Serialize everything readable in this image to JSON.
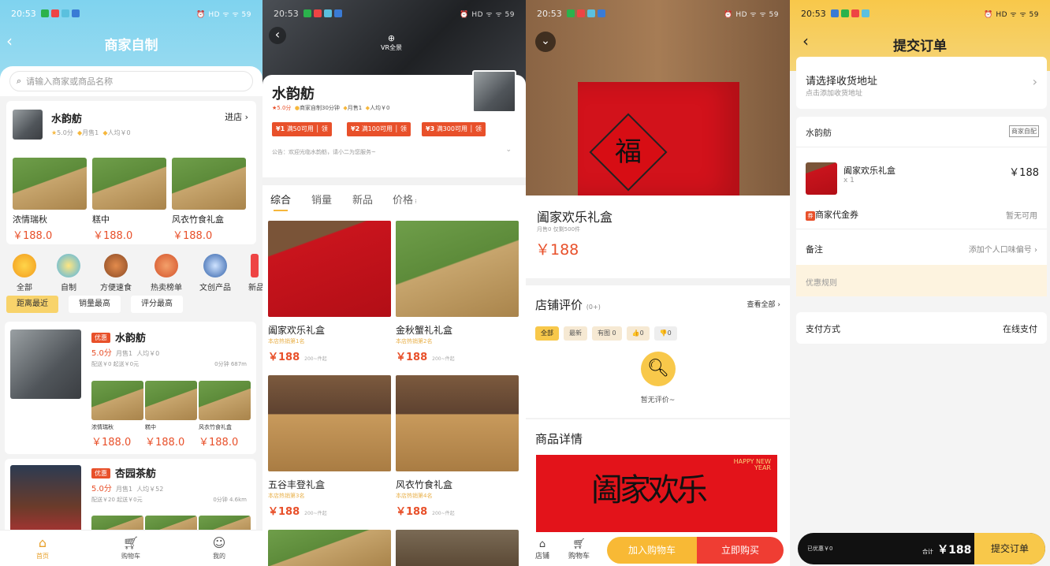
{
  "status": {
    "time": "20:53",
    "right": "⏰ HD ᯤ ᯤ 59"
  },
  "p1": {
    "title": "商家自制",
    "search_placeholder": "请输入商家或商品名称",
    "shop": {
      "name": "水韵舫",
      "enter": "进店",
      "score": "5.0分",
      "monthly": "月售1",
      "avg": "人均￥0"
    },
    "featured": [
      {
        "name": "浓情瑞秋",
        "price": "￥188.0"
      },
      {
        "name": "糕中",
        "price": "￥188.0"
      },
      {
        "name": "风衣竹食礼盒",
        "price": "￥188.0"
      }
    ],
    "categories": [
      "全部",
      "自制",
      "方便速食",
      "热卖榜单",
      "文创产品",
      "新品"
    ],
    "sorts": [
      "距离最近",
      "销量最高",
      "评分最高"
    ],
    "list": [
      {
        "tag": "优惠",
        "name": "水韵舫",
        "score": "5.0分",
        "monthly": "月售1",
        "avg": "人均￥0",
        "fee": "配送￥0  起送￥0元",
        "dist": "0分钟  687m",
        "items": [
          {
            "name": "浓情瑞秋",
            "price": "￥188.0"
          },
          {
            "name": "糕中",
            "price": "￥188.0"
          },
          {
            "name": "风衣竹食礼盒",
            "price": "￥188.0"
          }
        ]
      },
      {
        "tag": "优惠",
        "name": "杏园茶舫",
        "score": "5.0分",
        "monthly": "月售1",
        "avg": "人均￥52",
        "fee": "配送￥20  起送￥0元",
        "dist": "0分钟  4.6km"
      }
    ],
    "nav": [
      "首页",
      "购物车",
      "我的"
    ]
  },
  "p2": {
    "vr": "VR全景",
    "name": "水韵舫",
    "meta": [
      "5.0分",
      "商家自制30分钟",
      "月售1",
      "人均￥0"
    ],
    "coupons": [
      {
        "n": "¥1",
        "t": "满50可用",
        "b": "领"
      },
      {
        "n": "¥2",
        "t": "满100可用",
        "b": "领"
      },
      {
        "n": "¥3",
        "t": "满300可用",
        "b": "领"
      }
    ],
    "notice": "公告：欢迎光临水韵舫，请小二为您服务~",
    "tabs": [
      "综合",
      "销量",
      "新品",
      "价格"
    ],
    "goods": [
      {
        "name": "阖家欢乐礼盒",
        "sub": "本店热销第1名",
        "price": "￥188",
        "old": "200~件起"
      },
      {
        "name": "金秋蟹礼礼盒",
        "sub": "本店热销第2名",
        "price": "￥188",
        "old": "200~件起"
      },
      {
        "name": "五谷丰登礼盒",
        "sub": "本店热销第3名",
        "price": "￥188",
        "old": "200~件起"
      },
      {
        "name": "风衣竹食礼盒",
        "sub": "本店热销第4名",
        "price": "￥188",
        "old": "200~件起"
      }
    ]
  },
  "p3": {
    "fu": "福",
    "name": "阖家欢乐礼盒",
    "meta": "月售0    仅剩500件",
    "price": "￥188",
    "review_title": "店铺评价",
    "review_count": "(0+)",
    "view_all": "查看全部",
    "chips": [
      "全部",
      "最新",
      "有图 0",
      "👍0",
      "👎0"
    ],
    "empty": "暂无评价~",
    "detail_title": "商品详情",
    "banner_text": "HAPPY NEW YEAR",
    "banner_chars": "阖家欢乐",
    "bar": {
      "shop": "店铺",
      "cart": "购物车",
      "add": "加入购物车",
      "buy": "立即购买"
    }
  },
  "p4": {
    "title": "提交订单",
    "addr_title": "请选择收货地址",
    "addr_sub": "点击添加收货地址",
    "shop": "水韵舫",
    "badge": "商家自配",
    "item": {
      "name": "阖家欢乐礼盒",
      "qty": "x 1",
      "price": "￥188"
    },
    "coupon_label": "商家代金券",
    "coupon_val": "暂无可用",
    "note_label": "备注",
    "note_val": "添加个人口味偏号",
    "promo": "优惠规则",
    "pay_label": "支付方式",
    "pay_val": "在线支付",
    "bottom": {
      "saved": "已优惠￥0",
      "total_label": "合计",
      "total": "￥188",
      "submit": "提交订单"
    }
  },
  "colors": {
    "accent": "#e8502a",
    "yellow": "#f8c84a",
    "sky": "#7fd3ef"
  }
}
